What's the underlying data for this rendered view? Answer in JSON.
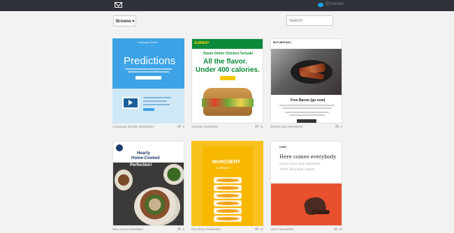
{
  "topbar": {
    "twitter_handle": "@zeedad"
  },
  "toolbar": {
    "browse_label": "Browse ▾",
    "search_placeholder": "Search"
  },
  "cards": [
    {
      "name": "Campaign Monitor Newsletter",
      "likes": "6",
      "preheader": "Campaign Monitor",
      "headline": "Predictions"
    },
    {
      "name": "Subway Newsletter",
      "likes": "11",
      "logo": "SUBWAY",
      "subtitle": "Sweet Onion Chicken Teriyaki",
      "headline1": "All the flavor.",
      "headline2": "Under 400 calories."
    },
    {
      "name": "Butcher Box Newsletter",
      "likes": "3",
      "brand": "BUTCHER BOX",
      "headline": "Free Bacon (go now)"
    },
    {
      "name": "Blue Apron Newsletter",
      "likes": "8",
      "headline1": "Hearty",
      "headline2": "Home-Cooked",
      "headline3": "Perfection!"
    },
    {
      "name": "Munchery Newsletter",
      "likes": "12",
      "headline1": "MUNCHERY",
      "headline2": "MORNING"
    },
    {
      "name": "Lemo Newsletter",
      "likes": "14",
      "brand": "LEMO",
      "headline": "Here comes everybody",
      "subtitle1": "Lemo now has Akismet",
      "subtitle2": "1099 Blocked Spam"
    }
  ]
}
